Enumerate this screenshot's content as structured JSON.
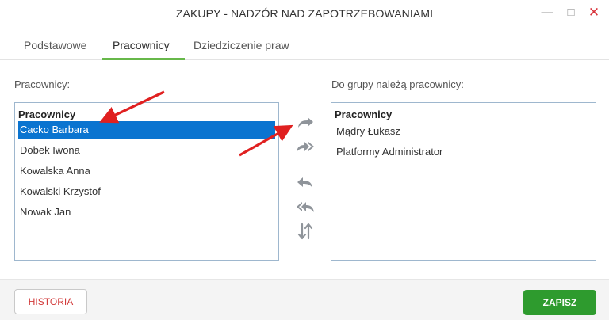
{
  "window": {
    "title": "ZAKUPY - NADZÓR NAD ZAPOTRZEBOWANIAMI",
    "controls": [
      "minimize",
      "maximize",
      "close"
    ]
  },
  "tabs": [
    {
      "label": "Podstawowe"
    },
    {
      "label": "Pracownicy",
      "active": true
    },
    {
      "label": "Dziedziczenie praw"
    }
  ],
  "left_panel": {
    "label": "Pracownicy:",
    "header": "Pracownicy",
    "items": [
      {
        "label": "Cacko Barbara",
        "selected": true
      },
      {
        "label": "Dobek Iwona"
      },
      {
        "label": "Kowalska Anna"
      },
      {
        "label": "Kowalski Krzystof"
      },
      {
        "label": "Nowak Jan"
      }
    ]
  },
  "right_panel": {
    "label": "Do grupy należą pracownicy:",
    "header": "Pracownicy",
    "items": [
      {
        "label": "Mądry Łukasz"
      },
      {
        "label": "Platformy Administrator"
      }
    ]
  },
  "transfer_buttons": [
    {
      "icon": "arrow-right-icon"
    },
    {
      "icon": "double-arrow-right-icon"
    },
    {
      "icon": "arrow-left-icon"
    },
    {
      "icon": "double-arrow-left-icon"
    },
    {
      "icon": "swap-icon"
    }
  ],
  "footer": {
    "history_label": "HISTORIA",
    "save_label": "ZAPISZ"
  },
  "colors": {
    "accent_green": "#67b84a",
    "selection_blue": "#0a74d0",
    "save_green": "#2e9b2e",
    "history_red": "#d23a3a",
    "annotation_red": "#e02020"
  }
}
